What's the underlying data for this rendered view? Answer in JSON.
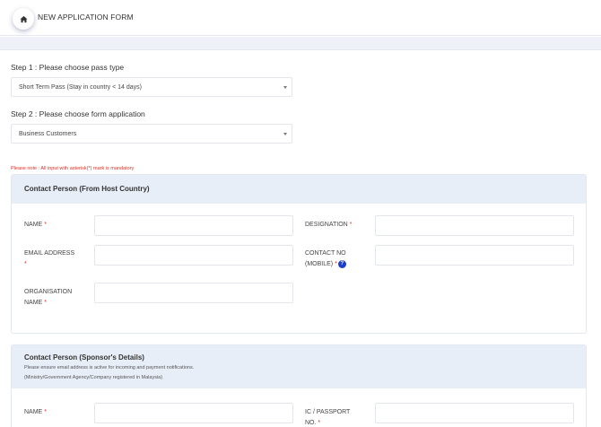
{
  "header": {
    "title": "NEW APPLICATION FORM",
    "home_icon": "home-icon"
  },
  "step1": {
    "label": "Step 1 : Please choose pass type",
    "value": "Short Term Pass (Stay in country < 14 days)"
  },
  "step2": {
    "label": "Step 2 : Please choose form application",
    "value": "Business Customers"
  },
  "note": "Please note : All input with asterisk(*) mark is mandatory",
  "host": {
    "title": "Contact Person (From Host Country)",
    "name_label": "NAME",
    "designation_label": "DESIGNATION",
    "email_label": "EMAIL ADDRESS",
    "contact_label_1": "CONTACT NO",
    "contact_label_2": "(MOBILE)",
    "org_label_1": "ORGANISATION",
    "org_label_2": "NAME",
    "required_mark": "*"
  },
  "sponsor": {
    "title": "Contact Person (Sponsor's Details)",
    "subtitle_1": "Please ensure email address is active for incoming and payment notifications.",
    "subtitle_2": "(Ministry/Government Agency/Company registered in Malaysia)",
    "name_label": "NAME",
    "ic_label_1": "IC / PASSPORT",
    "ic_label_2": "NO.",
    "required_mark": "*"
  },
  "colors": {
    "accent": "#1a3fc8",
    "required": "#d93025",
    "card_header": "#e8eef7"
  }
}
